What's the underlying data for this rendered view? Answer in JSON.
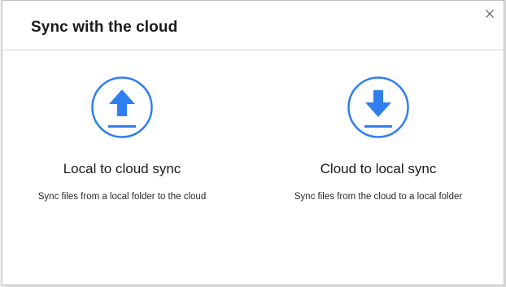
{
  "dialog": {
    "title": "Sync with the cloud",
    "close_icon": "close-icon"
  },
  "options": [
    {
      "icon": "upload-icon",
      "label": "Local to cloud sync",
      "description": "Sync files from a local folder to the cloud"
    },
    {
      "icon": "download-icon",
      "label": "Cloud to local sync",
      "description": "Sync files from the cloud to a local folder"
    }
  ],
  "colors": {
    "accent": "#2f7ff0",
    "title_text": "#1a1a1a",
    "border": "#d6d6d6"
  }
}
